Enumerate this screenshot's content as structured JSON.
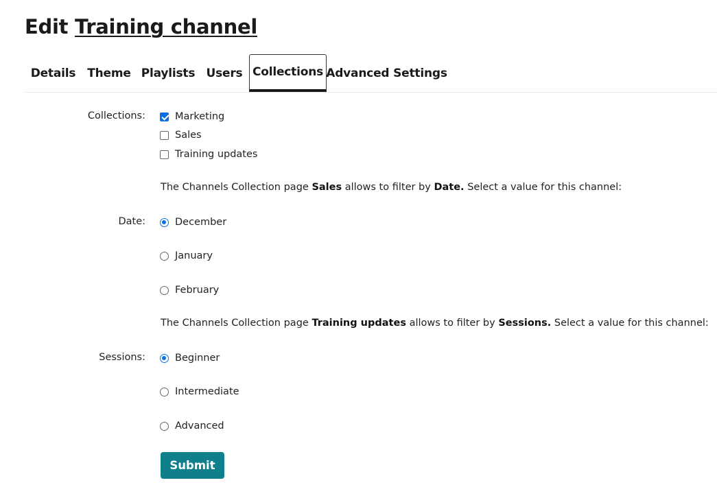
{
  "header": {
    "prefix": "Edit",
    "channel_name": "Training channel"
  },
  "tabs": [
    {
      "label": "Details",
      "active": false
    },
    {
      "label": "Theme",
      "active": false
    },
    {
      "label": "Playlists",
      "active": false
    },
    {
      "label": "Users",
      "active": false
    },
    {
      "label": "Collections",
      "active": true
    },
    {
      "label": "Advanced Settings",
      "active": false
    }
  ],
  "collections": {
    "label": "Collections:",
    "options": [
      {
        "label": "Marketing",
        "checked": true
      },
      {
        "label": "Sales",
        "checked": false
      },
      {
        "label": "Training updates",
        "checked": false
      }
    ]
  },
  "filters": [
    {
      "note": {
        "prefix": "The Channels Collection page",
        "collection": "Sales",
        "middle": "allows to filter by",
        "field": "Date.",
        "suffix": "Select a value for this channel:"
      },
      "label": "Date:",
      "options": [
        {
          "label": "December",
          "selected": true
        },
        {
          "label": "January",
          "selected": false
        },
        {
          "label": "February",
          "selected": false
        }
      ]
    },
    {
      "note": {
        "prefix": "The Channels Collection page",
        "collection": "Training updates",
        "middle": "allows to filter by",
        "field": "Sessions.",
        "suffix": "Select a value for this channel:"
      },
      "label": "Sessions:",
      "options": [
        {
          "label": "Beginner",
          "selected": true
        },
        {
          "label": "Intermediate",
          "selected": false
        },
        {
          "label": "Advanced",
          "selected": false
        }
      ]
    }
  ],
  "submit_label": "Submit",
  "colors": {
    "accent": "#0a6fe0",
    "submit": "#0f7f8c"
  }
}
